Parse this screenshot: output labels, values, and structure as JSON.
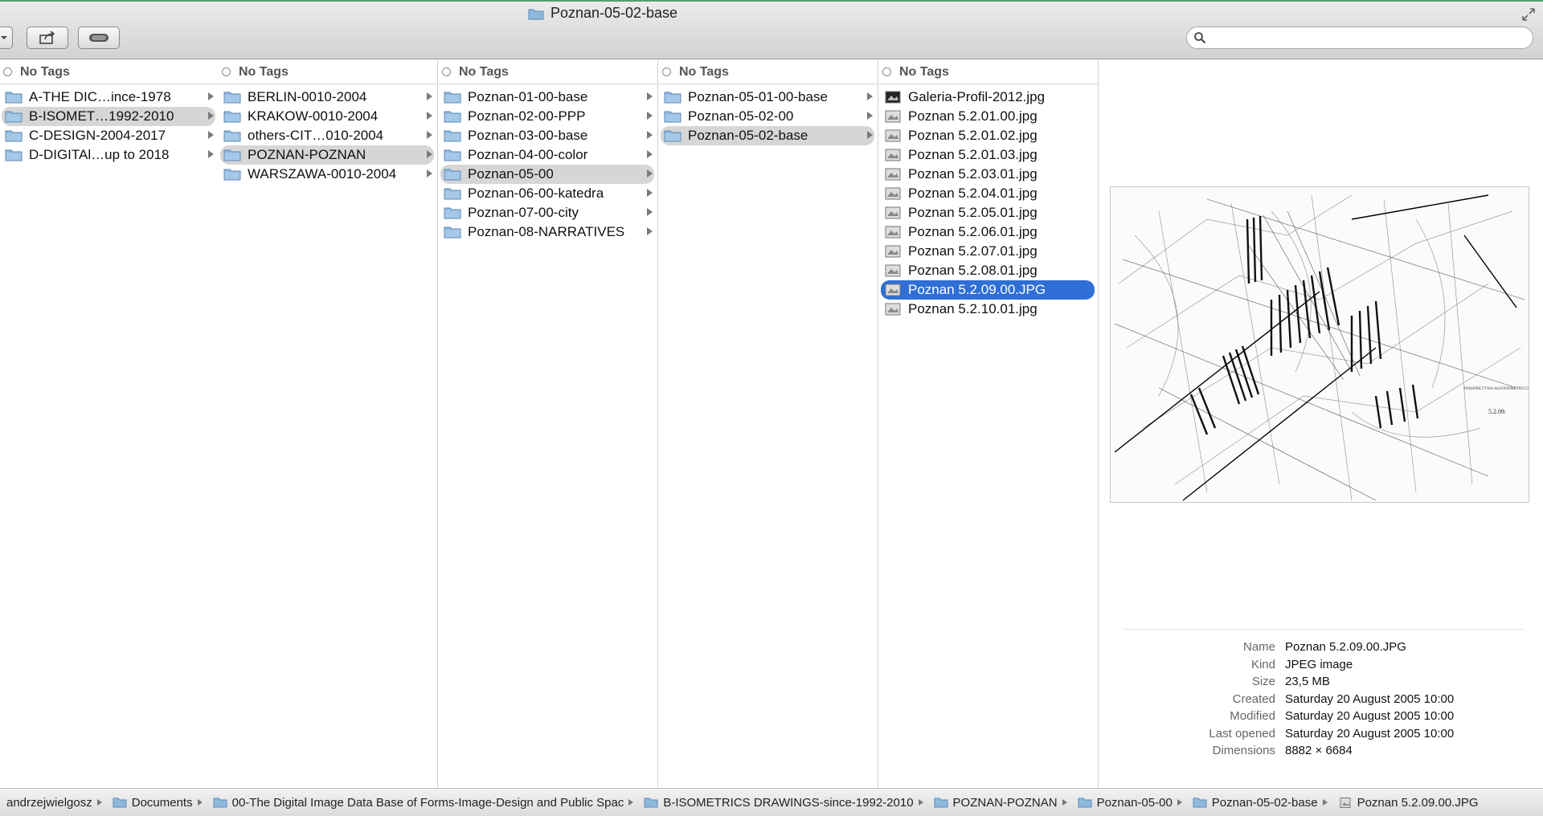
{
  "window": {
    "title": "Poznan-05-02-base"
  },
  "toolbar": {
    "search_placeholder": ""
  },
  "columns": [
    {
      "header": "No Tags",
      "items": [
        {
          "label": "A-THE DIC…ince-1978",
          "type": "folder",
          "arrow": true,
          "state": ""
        },
        {
          "label": "B-ISOMET…1992-2010",
          "type": "folder",
          "arrow": true,
          "state": "hl"
        },
        {
          "label": "C-DESIGN-2004-2017",
          "type": "folder",
          "arrow": true,
          "state": ""
        },
        {
          "label": "D-DIGITAl…up to 2018",
          "type": "folder",
          "arrow": true,
          "state": ""
        }
      ]
    },
    {
      "header": "No Tags",
      "items": [
        {
          "label": "BERLIN-0010-2004",
          "type": "folder",
          "arrow": true,
          "state": ""
        },
        {
          "label": "KRAKOW-0010-2004",
          "type": "folder",
          "arrow": true,
          "state": ""
        },
        {
          "label": "others-CIT…010-2004",
          "type": "folder",
          "arrow": true,
          "state": ""
        },
        {
          "label": "POZNAN-POZNAN",
          "type": "folder",
          "arrow": true,
          "state": "hl"
        },
        {
          "label": "WARSZAWA-0010-2004",
          "type": "folder",
          "arrow": true,
          "state": ""
        }
      ]
    },
    {
      "header": "No Tags",
      "items": [
        {
          "label": "Poznan-01-00-base",
          "type": "folder",
          "arrow": true,
          "state": ""
        },
        {
          "label": "Poznan-02-00-PPP",
          "type": "folder",
          "arrow": true,
          "state": ""
        },
        {
          "label": "Poznan-03-00-base",
          "type": "folder",
          "arrow": true,
          "state": ""
        },
        {
          "label": "Poznan-04-00-color",
          "type": "folder",
          "arrow": true,
          "state": ""
        },
        {
          "label": "Poznan-05-00",
          "type": "folder",
          "arrow": true,
          "state": "hl"
        },
        {
          "label": "Poznan-06-00-katedra",
          "type": "folder",
          "arrow": true,
          "state": ""
        },
        {
          "label": "Poznan-07-00-city",
          "type": "folder",
          "arrow": true,
          "state": ""
        },
        {
          "label": "Poznan-08-NARRATIVES",
          "type": "folder",
          "arrow": true,
          "state": ""
        }
      ]
    },
    {
      "header": "No Tags",
      "items": [
        {
          "label": "Poznan-05-01-00-base",
          "type": "folder",
          "arrow": true,
          "state": ""
        },
        {
          "label": "Poznan-05-02-00",
          "type": "folder",
          "arrow": true,
          "state": ""
        },
        {
          "label": "Poznan-05-02-base",
          "type": "folder",
          "arrow": true,
          "state": "hl"
        }
      ]
    },
    {
      "header": "No Tags",
      "items": [
        {
          "label": "Galeria-Profil-2012.jpg",
          "type": "image",
          "arrow": false,
          "state": ""
        },
        {
          "label": "Poznan 5.2.01.00.jpg",
          "type": "image",
          "arrow": false,
          "state": ""
        },
        {
          "label": "Poznan 5.2.01.02.jpg",
          "type": "image",
          "arrow": false,
          "state": ""
        },
        {
          "label": "Poznan 5.2.01.03.jpg",
          "type": "image",
          "arrow": false,
          "state": ""
        },
        {
          "label": "Poznan 5.2.03.01.jpg",
          "type": "image",
          "arrow": false,
          "state": ""
        },
        {
          "label": "Poznan 5.2.04.01.jpg",
          "type": "image",
          "arrow": false,
          "state": ""
        },
        {
          "label": "Poznan 5.2.05.01.jpg",
          "type": "image",
          "arrow": false,
          "state": ""
        },
        {
          "label": "Poznan 5.2.06.01.jpg",
          "type": "image",
          "arrow": false,
          "state": ""
        },
        {
          "label": "Poznan 5.2.07.01.jpg",
          "type": "image",
          "arrow": false,
          "state": ""
        },
        {
          "label": "Poznan 5.2.08.01.jpg",
          "type": "image",
          "arrow": false,
          "state": ""
        },
        {
          "label": "Poznan 5.2.09.00.JPG",
          "type": "image",
          "arrow": false,
          "state": "sel"
        },
        {
          "label": "Poznan 5.2.10.01.jpg",
          "type": "image",
          "arrow": false,
          "state": ""
        }
      ]
    }
  ],
  "preview": {
    "info": [
      {
        "key": "Name",
        "value": "Poznan 5.2.09.00.JPG"
      },
      {
        "key": "Kind",
        "value": "JPEG image"
      },
      {
        "key": "Size",
        "value": "23,5 MB"
      },
      {
        "key": "Created",
        "value": "Saturday 20 August 2005 10:00"
      },
      {
        "key": "Modified",
        "value": "Saturday 20 August 2005 10:00"
      },
      {
        "key": "Last opened",
        "value": "Saturday 20 August 2005 10:00"
      },
      {
        "key": "Dimensions",
        "value": "8882 × 6684"
      }
    ]
  },
  "pathbar": [
    {
      "label": "andrzejwielgosz",
      "icon": "home"
    },
    {
      "label": "Documents",
      "icon": "folder"
    },
    {
      "label": "00-The Digital Image Data Base of Forms-Image-Design and Public Spac",
      "icon": "folder"
    },
    {
      "label": "B-ISOMETRICS DRAWINGS-since-1992-2010",
      "icon": "folder"
    },
    {
      "label": "POZNAN-POZNAN",
      "icon": "folder"
    },
    {
      "label": "Poznan-05-00",
      "icon": "folder"
    },
    {
      "label": "Poznan-05-02-base",
      "icon": "folder"
    },
    {
      "label": "Poznan 5.2.09.00.JPG",
      "icon": "image"
    }
  ],
  "colors": {
    "selection": "#2f6fd6",
    "highlight": "#d6d6d6",
    "folder": "#8fb8dd"
  }
}
